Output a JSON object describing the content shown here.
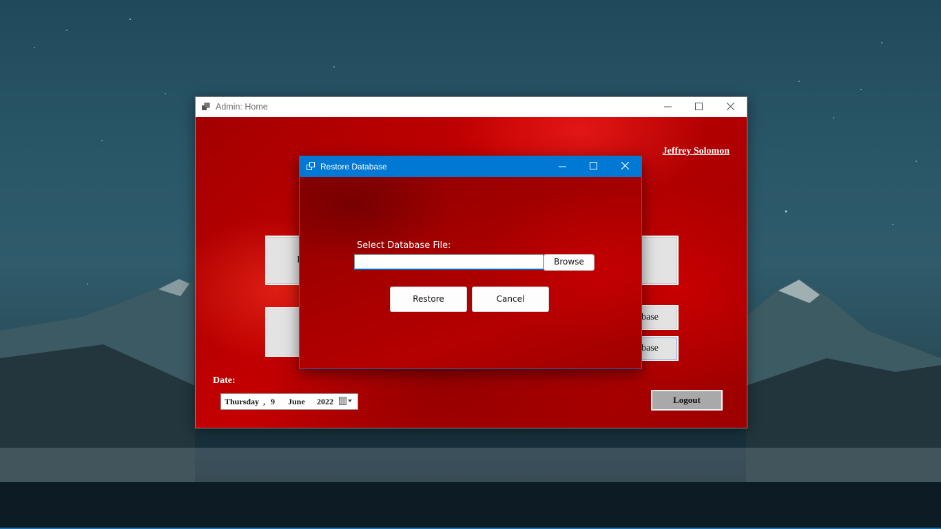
{
  "main_window": {
    "title": "Admin: Home",
    "user_name": "Jeffrey Solomon",
    "tile_fragments": {
      "row1_left": "I",
      "row2_right_top": "base",
      "row2_right_bottom": "base"
    },
    "date_label": "Date:",
    "date_picker": {
      "weekday": "Thursday",
      "separator": ",",
      "day": "9",
      "month": "June",
      "year": "2022"
    },
    "logout_label": "Logout"
  },
  "dialog": {
    "title": "Restore Database",
    "select_label": "Select Database File:",
    "file_input": {
      "value": "",
      "placeholder": ""
    },
    "browse_label": "Browse",
    "restore_label": "Restore",
    "cancel_label": "Cancel"
  },
  "colors": {
    "dialog_titlebar": "#0078d4",
    "window_background": "#b00000"
  },
  "icons": [
    "app-window-icon",
    "minimize-icon",
    "maximize-icon",
    "close-icon",
    "calendar-dropdown-icon"
  ]
}
